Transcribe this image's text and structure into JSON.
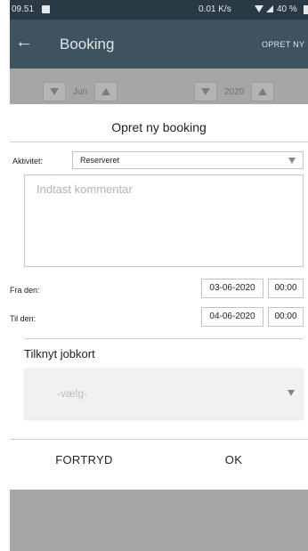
{
  "status_bar": {
    "time": "09.51",
    "network_speed": "0.01 K/s",
    "battery": "40 %"
  },
  "app_bar": {
    "back_icon": "arrow-left-icon",
    "title": "Booking",
    "action_label": "OPRET NY"
  },
  "background": {
    "month": "Jun",
    "year": "2020"
  },
  "dialog": {
    "title": "Opret ny booking",
    "activity_label": "Aktivitet:",
    "activity_value": "Reserveret",
    "comment_placeholder": "Indtast kommentar",
    "from_label": "Fra den:",
    "from_date": "03-06-2020",
    "from_time": "00:00",
    "to_label": "Til den:",
    "to_date": "04-06-2020",
    "to_time": "00:00",
    "jobcard_label": "Tilknyt jobkort",
    "jobcard_value": "-vælg-",
    "cancel_label": "FORTRYD",
    "ok_label": "OK"
  }
}
